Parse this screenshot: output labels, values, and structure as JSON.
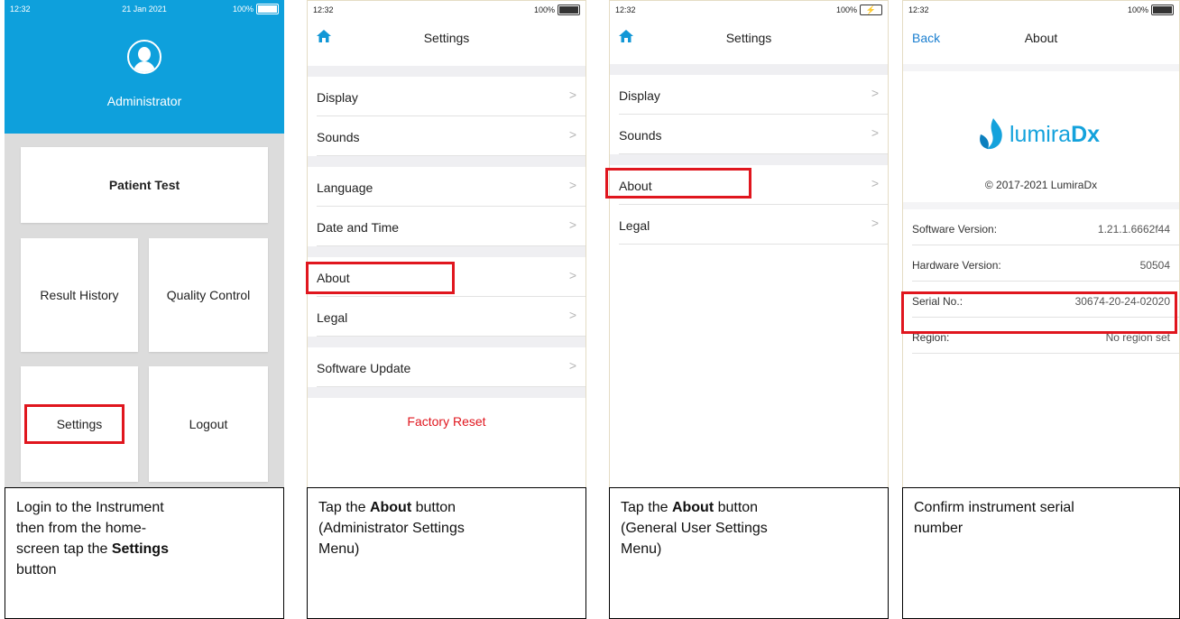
{
  "panel1": {
    "status": {
      "time": "12:32",
      "date": "21 Jan 2021",
      "battery": "100%"
    },
    "role": "Administrator",
    "patient_test": "Patient Test",
    "result_history": "Result History",
    "quality_control": "Quality Control",
    "settings": "Settings",
    "logout": "Logout",
    "caption": {
      "line1": "Login to the Instrument",
      "line2": "then from the home-",
      "line3_pre": "screen tap the ",
      "line3_bold": "Settings",
      "line4": "button"
    }
  },
  "panel2": {
    "status": {
      "time": "12:32",
      "battery": "100%"
    },
    "title": "Settings",
    "items": [
      "Display",
      "Sounds",
      "Language",
      "Date and Time",
      "About",
      "Legal",
      "Software Update"
    ],
    "factory_reset": "Factory Reset",
    "caption": {
      "pre": "Tap the ",
      "bold": "About",
      "post": " button",
      "line2": "(Administrator Settings",
      "line3": "Menu)"
    }
  },
  "panel3": {
    "status": {
      "time": "12:32",
      "battery": "100%"
    },
    "title": "Settings",
    "items": [
      "Display",
      "Sounds",
      "About",
      "Legal"
    ],
    "caption": {
      "pre": "Tap the ",
      "bold": "About",
      "post": " button",
      "line2": "(General User Settings",
      "line3": "Menu)"
    }
  },
  "panel4": {
    "status": {
      "time": "12:32",
      "battery": "100%"
    },
    "back": "Back",
    "title": "About",
    "logo": {
      "part1": "lumira",
      "part2": "Dx"
    },
    "copyright": "© 2017-2021 LumiraDx",
    "rows": [
      {
        "label": "Software Version:",
        "value": "1.21.1.6662f44"
      },
      {
        "label": "Hardware Version:",
        "value": "50504"
      },
      {
        "label": "Serial No.:",
        "value": "30674-20-24-02020"
      },
      {
        "label": "Region:",
        "value": "No region set"
      }
    ],
    "caption": {
      "line1": "Confirm instrument serial",
      "line2": "number"
    }
  },
  "colors": {
    "brand_blue": "#0ea0dc",
    "highlight_red": "#e0161e",
    "link_blue": "#1b7fd0"
  },
  "icons": [
    "user-avatar-icon",
    "home-icon",
    "chevron-right-icon",
    "battery-icon",
    "charging-battery-icon",
    "lumiradx-logo"
  ]
}
